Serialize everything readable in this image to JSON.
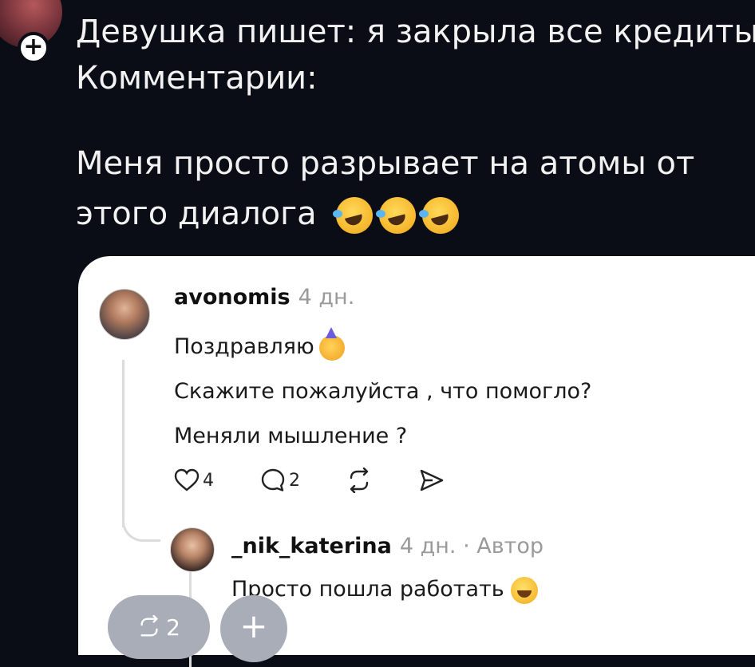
{
  "post": {
    "title": "Девушка пишет: я закрыла все кредиты",
    "subtitle": "Комментарии:",
    "body_text": "Меня просто разрывает на атомы от этого диалога",
    "emojis": [
      "rolling-on-floor-laughing",
      "rolling-on-floor-laughing",
      "rolling-on-floor-laughing"
    ]
  },
  "comment1": {
    "username": "avonomis",
    "time": "4 дн.",
    "lines": [
      "Поздравляю",
      "Скажите пожалуйста , что помогло?",
      "Меняли мышление ?"
    ],
    "likes": "4",
    "replies": "2"
  },
  "comment2": {
    "username": "_nik_katerina",
    "time": "4 дн.",
    "author_badge": "· Автор",
    "text": "Просто пошла работать"
  },
  "floating": {
    "repost_count": "2"
  }
}
